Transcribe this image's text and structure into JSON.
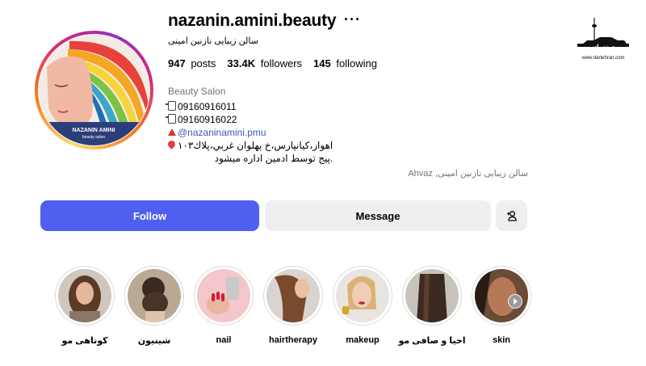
{
  "profile": {
    "username": "nazanin.amini.beauty",
    "full_name": "سالن زیبایی نازنین امینی",
    "avatar_text": {
      "name": "NAZANIN AMINI",
      "tag": "beauty salon"
    },
    "stats": {
      "posts_value": "947",
      "posts_label": "posts",
      "followers_value": "33.4K",
      "followers_label": "followers",
      "following_value": "145",
      "following_label": "following"
    },
    "bio": {
      "category": "Beauty Salon",
      "phone1": "09160916011",
      "phone2": "09160916022",
      "link": "@nazaninamini.pmu",
      "address": "اهواز،کیانپارس،خ پهلوان غربي،پلاك۱۰۳",
      "note": ".پیج توسط ادمین اداره میشود"
    },
    "location": "سالن زیبایی نازنین امینی, Ahvaz"
  },
  "actions": {
    "follow_label": "Follow",
    "message_label": "Message",
    "more_label": "···"
  },
  "watermark": {
    "brand": "درتهران",
    "url": "www.dartehran.com"
  },
  "highlights": [
    {
      "label": "کوتاهی مو",
      "icon": "haircut-photo"
    },
    {
      "label": "شینیون",
      "icon": "updo-photo"
    },
    {
      "label": "nail",
      "icon": "nail-photo"
    },
    {
      "label": "hairtherapy",
      "icon": "hairtherapy-photo"
    },
    {
      "label": "makeup",
      "icon": "makeup-photo"
    },
    {
      "label": "احیا و صافی مو",
      "icon": "hair-straightening-photo"
    },
    {
      "label": "skin",
      "icon": "skin-photo"
    }
  ],
  "colors": {
    "follow_button": "#4f5ff0",
    "secondary_button": "#efeff1",
    "link": "#3d5ab8",
    "muted_text": "#737373"
  }
}
